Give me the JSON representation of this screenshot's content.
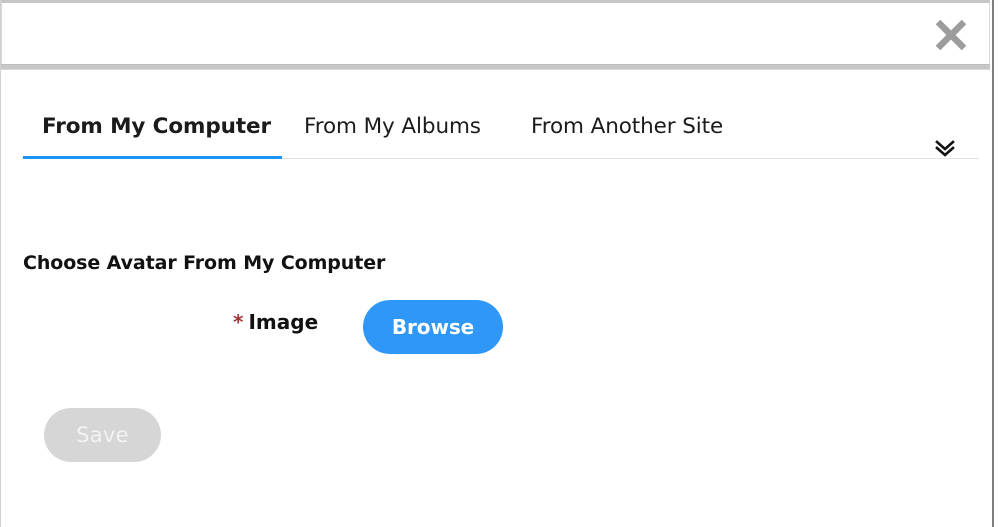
{
  "dialog": {
    "title": "",
    "close_label": "Close",
    "close_icon": "close-x-icon"
  },
  "tabs": {
    "overflow_icon": "double-chevron-down-icon",
    "items": [
      {
        "label": "From My Computer",
        "active": true
      },
      {
        "label": "From My Albums",
        "active": false
      },
      {
        "label": "From Another Site",
        "active": false
      }
    ]
  },
  "content": {
    "heading": "Choose Avatar From My Computer",
    "field": {
      "required_marker": "*",
      "label": "Image",
      "browse_label": "Browse"
    },
    "save_label": "Save"
  },
  "colors": {
    "accent_blue": "#2e97f7",
    "tab_underline": "#1f94f7",
    "required_red": "#a03737",
    "disabled_grey": "#d6d6d6",
    "close_icon_grey": "#9c9c9c",
    "divider_grey": "#c8c8c8"
  }
}
